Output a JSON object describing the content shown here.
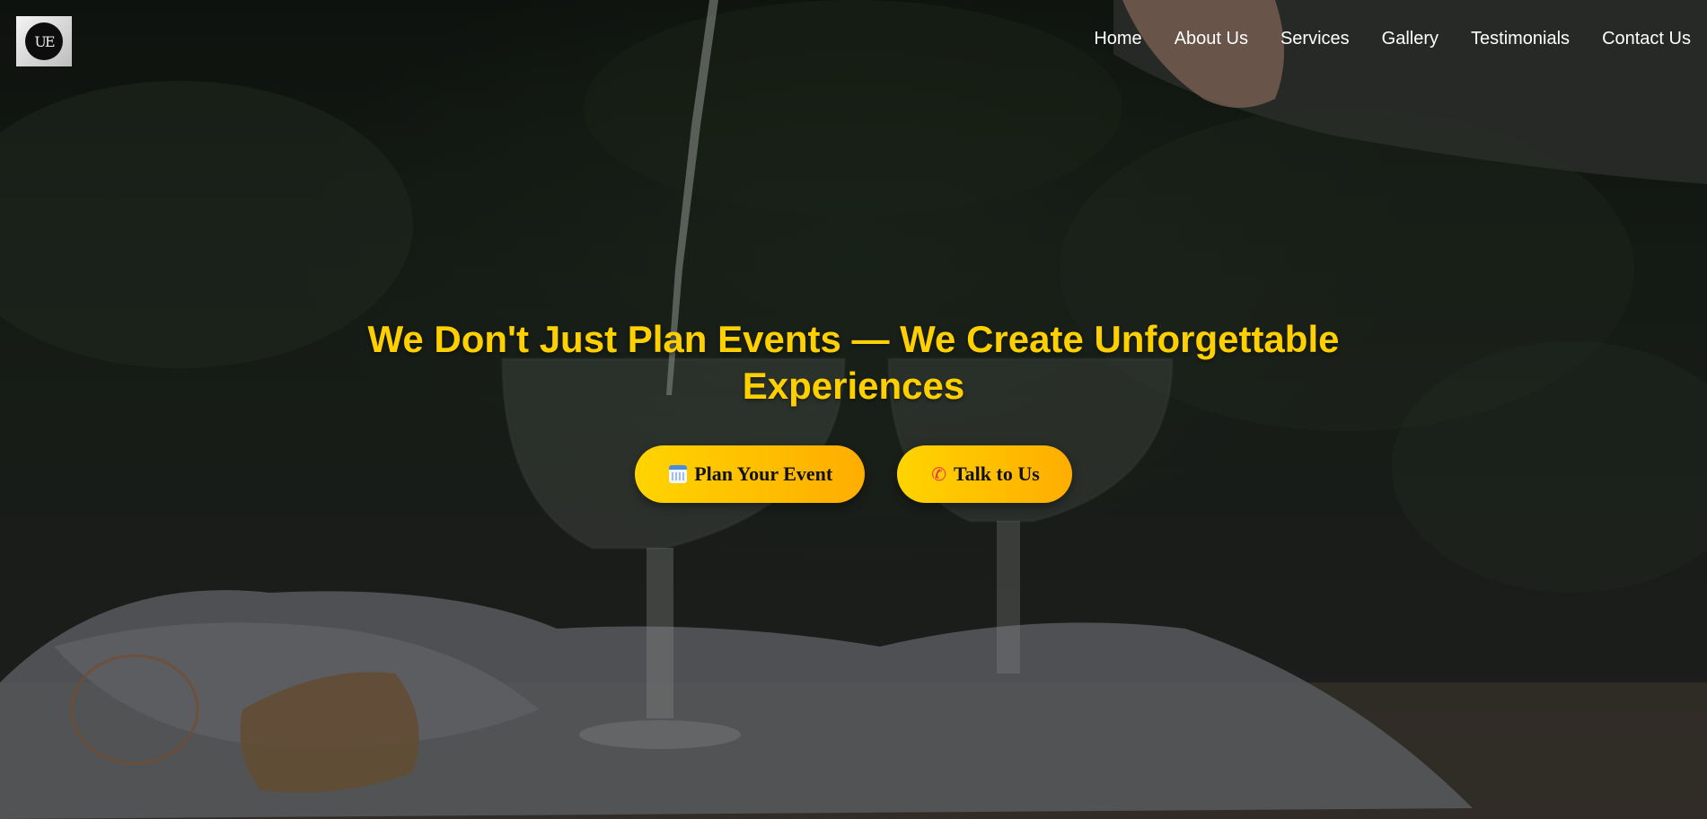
{
  "nav": {
    "items": [
      {
        "label": "Home"
      },
      {
        "label": "About Us"
      },
      {
        "label": "Services"
      },
      {
        "label": "Gallery"
      },
      {
        "label": "Testimonials"
      },
      {
        "label": "Contact Us"
      }
    ]
  },
  "logo": {
    "text": "UE"
  },
  "hero": {
    "title": "We Don't Just Plan Events — We Create Unforgettable Experiences",
    "buttons": [
      {
        "label": "Plan Your Event",
        "icon": "calendar-icon"
      },
      {
        "label": "Talk to Us",
        "icon": "phone-icon"
      }
    ]
  },
  "colors": {
    "accent": "#ffd000",
    "button_gradient_start": "#ffd400",
    "button_gradient_end": "#ffad00",
    "nav_text": "#ffffff"
  }
}
